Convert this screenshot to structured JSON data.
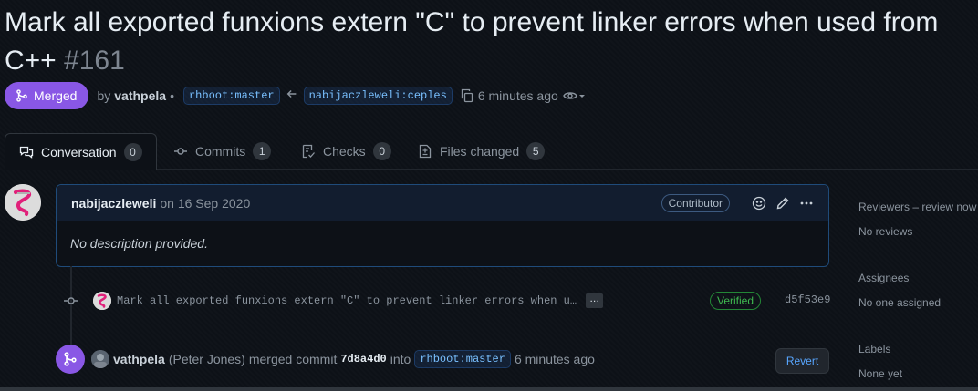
{
  "pr": {
    "title": "Mark all exported funxions extern \"C\" to prevent linker errors when used from C++",
    "number": "#161",
    "state": "Merged",
    "by_label": "by",
    "author": "vathpela",
    "bullet": "•",
    "base_branch": "rhboot:master",
    "head_branch": "nabijaczleweli:ceples",
    "time": "6 minutes ago"
  },
  "tabs": [
    {
      "label": "Conversation",
      "count": "0",
      "icon": "comment-discussion-icon"
    },
    {
      "label": "Commits",
      "count": "1",
      "icon": "git-commit-icon"
    },
    {
      "label": "Checks",
      "count": "0",
      "icon": "checklist-icon"
    },
    {
      "label": "Files changed",
      "count": "5",
      "icon": "file-diff-icon"
    }
  ],
  "comment": {
    "author": "nabijaczleweli",
    "date_text": "on 16 Sep 2020",
    "role": "Contributor",
    "body": "No description provided."
  },
  "commit": {
    "message": "Mark all exported funxions extern \"C\" to prevent linker errors when u…",
    "expand": "…",
    "verified": "Verified",
    "sha": "d5f53e9"
  },
  "merge_event": {
    "actor": "vathpela",
    "actor_name": "(Peter Jones)",
    "action": "merged commit",
    "sha": "7d8a4d0",
    "into": "into",
    "branch": "rhboot:master",
    "time": "6 minutes ago",
    "revert_label": "Revert"
  },
  "sidebar": {
    "reviewers": {
      "heading": "Reviewers – review now",
      "value": "No reviews"
    },
    "assignees": {
      "heading": "Assignees",
      "value": "No one assigned"
    },
    "labels": {
      "heading": "Labels",
      "value": "None yet"
    }
  },
  "colors": {
    "merged": "#8957e5",
    "link": "#58a6ff",
    "verified": "#3fb950",
    "background": "#0d1117"
  }
}
